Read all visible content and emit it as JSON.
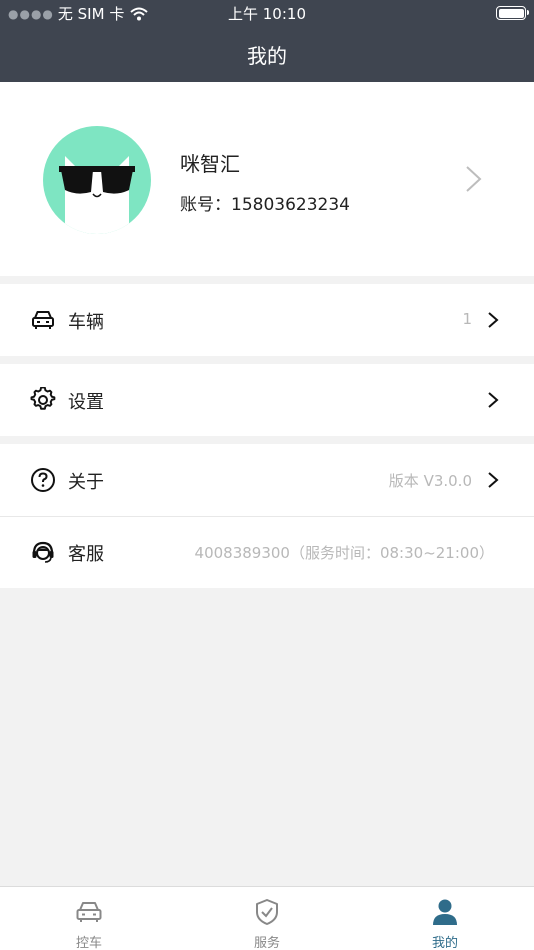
{
  "status_bar": {
    "carrier": "无 SIM 卡",
    "time": "上午 10:10"
  },
  "header": {
    "title": "我的"
  },
  "profile": {
    "name": "咪智汇",
    "account": "账号：15803623234"
  },
  "menu": {
    "vehicle": {
      "label": "车辆",
      "value": "1"
    },
    "settings": {
      "label": "设置"
    },
    "about": {
      "label": "关于",
      "value": "版本 V3.0.0"
    },
    "service": {
      "label": "客服",
      "value": "4008389300（服务时间：08:30~21:00）"
    }
  },
  "tabbar": {
    "tabs": [
      {
        "label": "控车",
        "icon": "car-icon"
      },
      {
        "label": "服务",
        "icon": "shield-check-icon"
      },
      {
        "label": "我的",
        "icon": "user-icon"
      }
    ],
    "active_index": 2
  },
  "colors": {
    "header_bg": "#3f4550",
    "avatar_bg": "#7ee5c2",
    "active_tab": "#2f6c8a"
  }
}
